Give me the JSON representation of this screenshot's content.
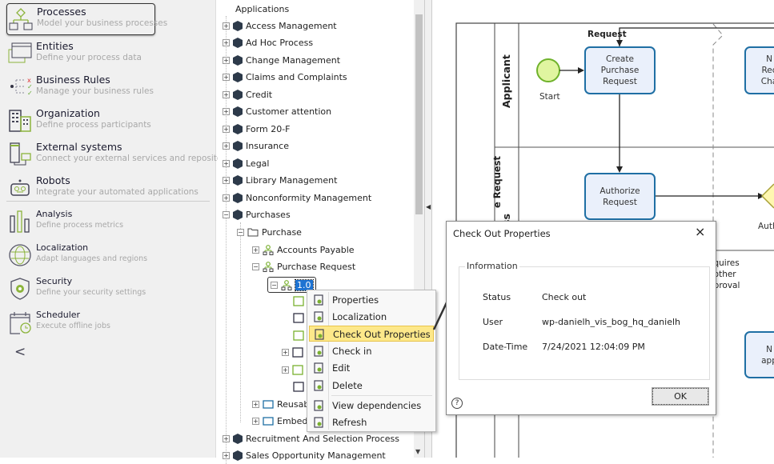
{
  "nav": {
    "items": [
      {
        "title": "Processes",
        "subtitle": "Model your business processes",
        "icon": "processes-icon",
        "selected": true
      },
      {
        "title": "Entities",
        "subtitle": "Define your process data",
        "icon": "entities-icon"
      },
      {
        "title": "Business Rules",
        "subtitle": "Manage your business rules",
        "icon": "business-rules-icon"
      },
      {
        "title": "Organization",
        "subtitle": "Define process participants",
        "icon": "organization-icon"
      },
      {
        "title": "External systems",
        "subtitle": "Connect your external services and repositories",
        "icon": "external-systems-icon"
      },
      {
        "title": "Robots",
        "subtitle": "Integrate your automated applications",
        "icon": "robot-icon"
      },
      {
        "title": "Analysis",
        "subtitle": "Define process metrics",
        "icon": "analysis-icon"
      },
      {
        "title": "Localization",
        "subtitle": "Adapt languages and regions",
        "icon": "globe-icon"
      },
      {
        "title": "Security",
        "subtitle": "Define your security settings",
        "icon": "shield-icon"
      },
      {
        "title": "Scheduler",
        "subtitle": "Execute offline jobs",
        "icon": "calendar-icon"
      }
    ],
    "collapse": "<"
  },
  "tree": {
    "root": "Applications",
    "apps": [
      "Access Management",
      "Ad Hoc Process",
      "Change Management",
      "Claims and Complaints",
      "Credit",
      "Customer attention",
      "Form 20-F",
      "Insurance",
      "Legal",
      "Library Management",
      "Nonconformity Management",
      "Purchases"
    ],
    "purchase": "Purchase",
    "accounts_payable": "Accounts Payable",
    "purchase_request": "Purchase Request",
    "version": "1.0",
    "reusable": "Reusab",
    "embedded": "Embed",
    "after": [
      "Recruitment And Selection Process",
      "Sales Opportunity Management"
    ]
  },
  "context_menu": {
    "items": [
      "Properties",
      "Localization",
      "Check Out Properties",
      "Check in",
      "Edit",
      "Delete",
      "View dependencies",
      "Refresh"
    ],
    "highlighted": "Check Out Properties"
  },
  "dialog": {
    "title": "Check Out Properties",
    "group": "Information",
    "fields": [
      {
        "label": "Status",
        "value": "Check out"
      },
      {
        "label": "User",
        "value": "wp-danielh_vis_bog_hq_danielh"
      },
      {
        "label": "Date-Time",
        "value": "7/24/2021 12:04:09 PM"
      }
    ],
    "ok": "OK",
    "close": "×",
    "help": "?"
  },
  "diagram": {
    "pool": "e Request",
    "lane1": "Applicant",
    "lane2": "ss",
    "flow_label": "Request",
    "start": "Start",
    "task1": "Create Purchase Request",
    "task2": "Authorize Request",
    "task3": "N Rec Cha",
    "task4": "N app",
    "gateway": "Auth",
    "note": "equires nother pproval"
  },
  "colors": {
    "task_border": "#1f6fa4",
    "task_fill": "#eaf0fb",
    "start_fill": "#e0f5a0",
    "start_border": "#6fb22b",
    "highlight": "#fde88a",
    "gateway": "#fff7b0"
  }
}
